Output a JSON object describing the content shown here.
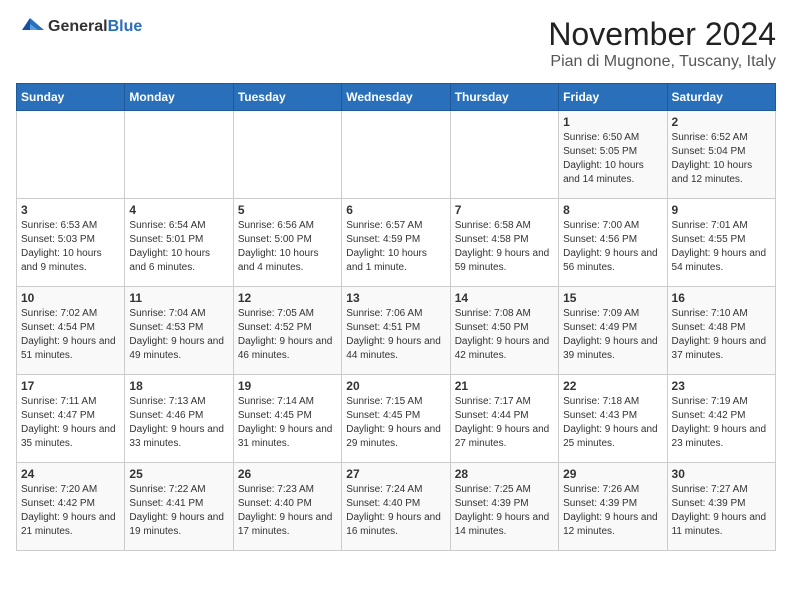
{
  "header": {
    "logo_general": "General",
    "logo_blue": "Blue",
    "month_title": "November 2024",
    "location": "Pian di Mugnone, Tuscany, Italy"
  },
  "weekdays": [
    "Sunday",
    "Monday",
    "Tuesday",
    "Wednesday",
    "Thursday",
    "Friday",
    "Saturday"
  ],
  "weeks": [
    [
      {
        "day": "",
        "info": ""
      },
      {
        "day": "",
        "info": ""
      },
      {
        "day": "",
        "info": ""
      },
      {
        "day": "",
        "info": ""
      },
      {
        "day": "",
        "info": ""
      },
      {
        "day": "1",
        "info": "Sunrise: 6:50 AM\nSunset: 5:05 PM\nDaylight: 10 hours and 14 minutes."
      },
      {
        "day": "2",
        "info": "Sunrise: 6:52 AM\nSunset: 5:04 PM\nDaylight: 10 hours and 12 minutes."
      }
    ],
    [
      {
        "day": "3",
        "info": "Sunrise: 6:53 AM\nSunset: 5:03 PM\nDaylight: 10 hours and 9 minutes."
      },
      {
        "day": "4",
        "info": "Sunrise: 6:54 AM\nSunset: 5:01 PM\nDaylight: 10 hours and 6 minutes."
      },
      {
        "day": "5",
        "info": "Sunrise: 6:56 AM\nSunset: 5:00 PM\nDaylight: 10 hours and 4 minutes."
      },
      {
        "day": "6",
        "info": "Sunrise: 6:57 AM\nSunset: 4:59 PM\nDaylight: 10 hours and 1 minute."
      },
      {
        "day": "7",
        "info": "Sunrise: 6:58 AM\nSunset: 4:58 PM\nDaylight: 9 hours and 59 minutes."
      },
      {
        "day": "8",
        "info": "Sunrise: 7:00 AM\nSunset: 4:56 PM\nDaylight: 9 hours and 56 minutes."
      },
      {
        "day": "9",
        "info": "Sunrise: 7:01 AM\nSunset: 4:55 PM\nDaylight: 9 hours and 54 minutes."
      }
    ],
    [
      {
        "day": "10",
        "info": "Sunrise: 7:02 AM\nSunset: 4:54 PM\nDaylight: 9 hours and 51 minutes."
      },
      {
        "day": "11",
        "info": "Sunrise: 7:04 AM\nSunset: 4:53 PM\nDaylight: 9 hours and 49 minutes."
      },
      {
        "day": "12",
        "info": "Sunrise: 7:05 AM\nSunset: 4:52 PM\nDaylight: 9 hours and 46 minutes."
      },
      {
        "day": "13",
        "info": "Sunrise: 7:06 AM\nSunset: 4:51 PM\nDaylight: 9 hours and 44 minutes."
      },
      {
        "day": "14",
        "info": "Sunrise: 7:08 AM\nSunset: 4:50 PM\nDaylight: 9 hours and 42 minutes."
      },
      {
        "day": "15",
        "info": "Sunrise: 7:09 AM\nSunset: 4:49 PM\nDaylight: 9 hours and 39 minutes."
      },
      {
        "day": "16",
        "info": "Sunrise: 7:10 AM\nSunset: 4:48 PM\nDaylight: 9 hours and 37 minutes."
      }
    ],
    [
      {
        "day": "17",
        "info": "Sunrise: 7:11 AM\nSunset: 4:47 PM\nDaylight: 9 hours and 35 minutes."
      },
      {
        "day": "18",
        "info": "Sunrise: 7:13 AM\nSunset: 4:46 PM\nDaylight: 9 hours and 33 minutes."
      },
      {
        "day": "19",
        "info": "Sunrise: 7:14 AM\nSunset: 4:45 PM\nDaylight: 9 hours and 31 minutes."
      },
      {
        "day": "20",
        "info": "Sunrise: 7:15 AM\nSunset: 4:45 PM\nDaylight: 9 hours and 29 minutes."
      },
      {
        "day": "21",
        "info": "Sunrise: 7:17 AM\nSunset: 4:44 PM\nDaylight: 9 hours and 27 minutes."
      },
      {
        "day": "22",
        "info": "Sunrise: 7:18 AM\nSunset: 4:43 PM\nDaylight: 9 hours and 25 minutes."
      },
      {
        "day": "23",
        "info": "Sunrise: 7:19 AM\nSunset: 4:42 PM\nDaylight: 9 hours and 23 minutes."
      }
    ],
    [
      {
        "day": "24",
        "info": "Sunrise: 7:20 AM\nSunset: 4:42 PM\nDaylight: 9 hours and 21 minutes."
      },
      {
        "day": "25",
        "info": "Sunrise: 7:22 AM\nSunset: 4:41 PM\nDaylight: 9 hours and 19 minutes."
      },
      {
        "day": "26",
        "info": "Sunrise: 7:23 AM\nSunset: 4:40 PM\nDaylight: 9 hours and 17 minutes."
      },
      {
        "day": "27",
        "info": "Sunrise: 7:24 AM\nSunset: 4:40 PM\nDaylight: 9 hours and 16 minutes."
      },
      {
        "day": "28",
        "info": "Sunrise: 7:25 AM\nSunset: 4:39 PM\nDaylight: 9 hours and 14 minutes."
      },
      {
        "day": "29",
        "info": "Sunrise: 7:26 AM\nSunset: 4:39 PM\nDaylight: 9 hours and 12 minutes."
      },
      {
        "day": "30",
        "info": "Sunrise: 7:27 AM\nSunset: 4:39 PM\nDaylight: 9 hours and 11 minutes."
      }
    ]
  ]
}
